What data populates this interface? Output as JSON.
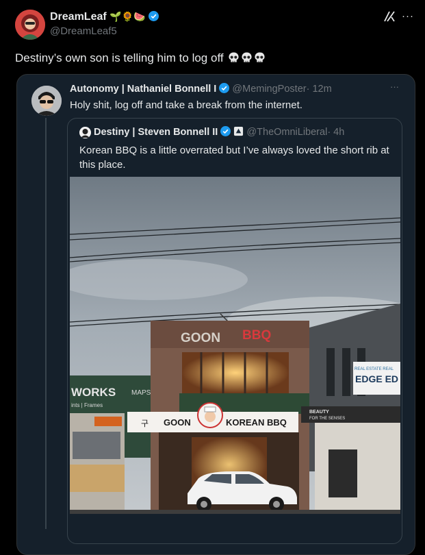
{
  "post": {
    "author_name": "DreamLeaf",
    "author_emoji": "🌱🌻🍉",
    "author_handle": "@DreamLeaf5",
    "more": "···",
    "text": "Destiny’s own son is telling him to log off"
  },
  "quote": {
    "author_name": "Autonomy | Nathaniel Bonnell I",
    "author_handle": "@MemingPoster",
    "time": "· 12m",
    "more": "···",
    "text": "Holy shit, log off and take a break from the internet."
  },
  "nested_quote": {
    "author_name": "Destiny | Steven Bonnell II",
    "author_handle": "@TheOmniLiberal",
    "time": "· 4h",
    "text": "Korean BBQ is a little overrated but I’ve always loved the short rib at this place."
  },
  "photo": {
    "restaurant_sign_left": "GOON",
    "restaurant_sign_right": "BBQ",
    "awning_left": "GOON",
    "awning_right": "KOREAN BBQ",
    "awning_korean": "구",
    "works_sign": "WORKS",
    "maps_sign": "MAPS",
    "prints_frames": "ints | Frames",
    "realestate_top": "REAL ESTATE REAL",
    "realestate_name": "EDGE ED",
    "beauty_line1": "BEAUTY",
    "beauty_line2": "FOR THE SENSES"
  },
  "colors": {
    "background": "#000000",
    "card": "#15202b",
    "verified": "#1d9bf0",
    "muted": "#71767b"
  }
}
